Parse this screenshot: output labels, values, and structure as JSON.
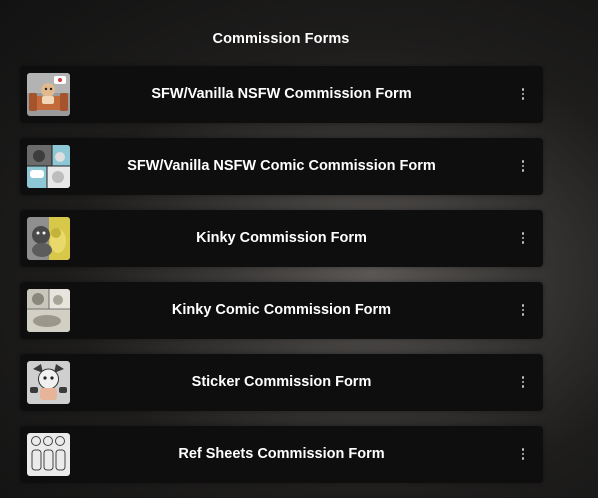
{
  "page": {
    "heading": "Commission Forms"
  },
  "links": [
    {
      "title": "SFW/Vanilla NSFW Commission Form",
      "thumbnail": "character-on-couch-image"
    },
    {
      "title": "SFW/Vanilla NSFW Comic Commission Form",
      "thumbnail": "comic-panels-image"
    },
    {
      "title": "Kinky Commission Form",
      "thumbnail": "creatures-yellow-image"
    },
    {
      "title": "Kinky Comic Commission Form",
      "thumbnail": "comic-sketch-image"
    },
    {
      "title": "Sticker Commission Form",
      "thumbnail": "sticker-character-image"
    },
    {
      "title": "Ref Sheets Commission Form",
      "thumbnail": "ref-sheet-image"
    }
  ],
  "icons": {
    "more": "more-vertical-icon"
  },
  "colors": {
    "card_background": "#0e0e0e",
    "text": "#ffffff",
    "dots": "#bdbdbd"
  }
}
